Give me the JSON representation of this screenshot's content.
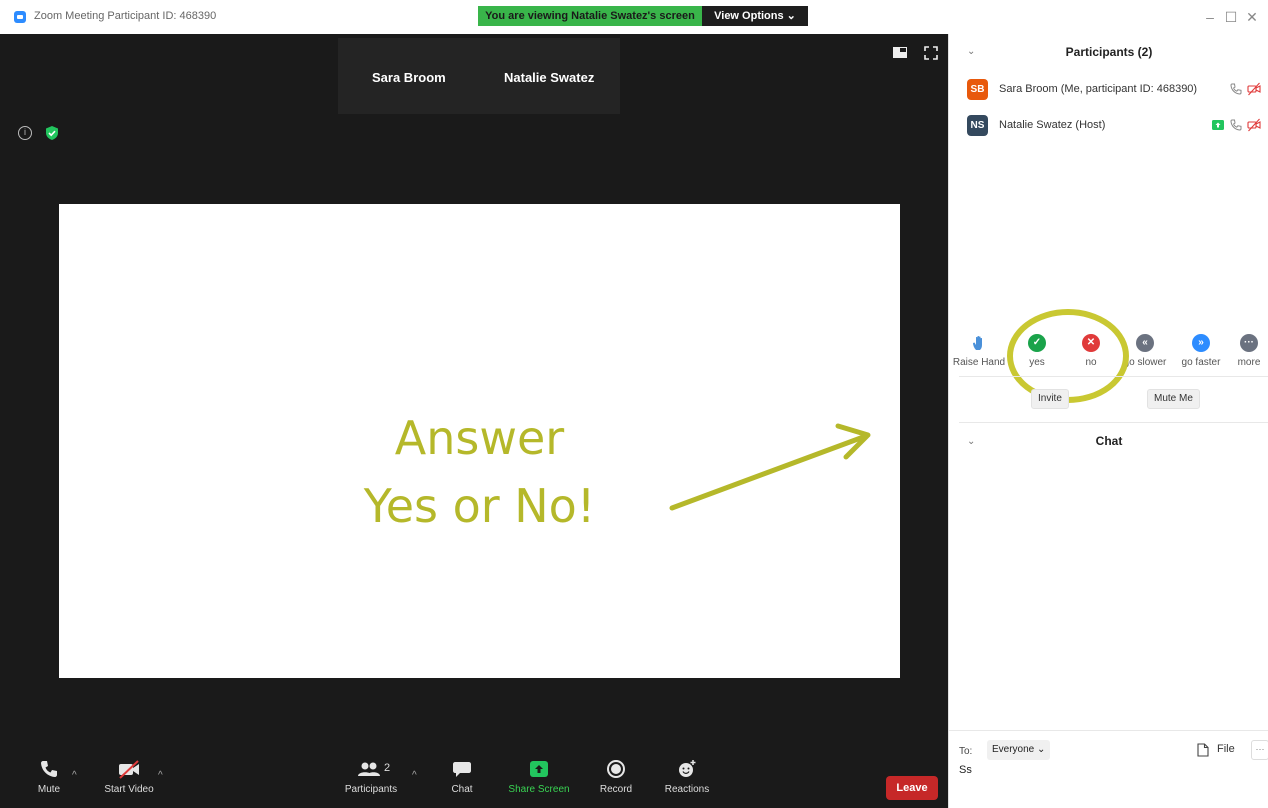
{
  "window": {
    "title": "Zoom Meeting Participant ID: 468390",
    "share_banner": "You are viewing Natalie Swatez's screen",
    "view_options": "View Options ⌄",
    "minimize": "–",
    "maximize": "☐",
    "close": "✕"
  },
  "gallery": {
    "names": [
      "Sara Broom",
      "Natalie Swatez"
    ]
  },
  "shared_content": {
    "line1": "Answer",
    "line2": "Yes or No!",
    "annotation_color": "#b5b82a"
  },
  "toolbar": {
    "mute": "Mute",
    "start_video": "Start Video",
    "participants": "Participants",
    "participants_count": "2",
    "chat": "Chat",
    "share_screen": "Share Screen",
    "record": "Record",
    "reactions": "Reactions",
    "leave": "Leave",
    "caret": "^"
  },
  "participants_panel": {
    "title": "Participants (2)",
    "chevron": "⌄",
    "people": [
      {
        "initials": "SB",
        "name": "Sara Broom (Me, participant ID: 468390)",
        "avatar_color": "#e8590c"
      },
      {
        "initials": "NS",
        "name": "Natalie Swatez (Host)",
        "avatar_color": "#34495e"
      }
    ],
    "feedback": [
      {
        "label": "Raise Hand",
        "icon": "hand-icon",
        "color": "#4a90d9"
      },
      {
        "label": "yes",
        "icon": "check-icon",
        "color": "#1aa34a"
      },
      {
        "label": "no",
        "icon": "x-icon",
        "color": "#e03a3a"
      },
      {
        "label": "go slower",
        "icon": "rewind-icon",
        "color": "#6b7280"
      },
      {
        "label": "go faster",
        "icon": "fast-forward-icon",
        "color": "#2d8cff"
      },
      {
        "label": "more",
        "icon": "more-icon",
        "color": "#6b7280"
      }
    ],
    "invite": "Invite",
    "mute_me": "Mute Me"
  },
  "chat_panel": {
    "title": "Chat",
    "chevron": "⌄",
    "to_label": "To:",
    "to_value": "Everyone ⌄",
    "file": "File",
    "more": "···",
    "input_value": "Ss"
  }
}
